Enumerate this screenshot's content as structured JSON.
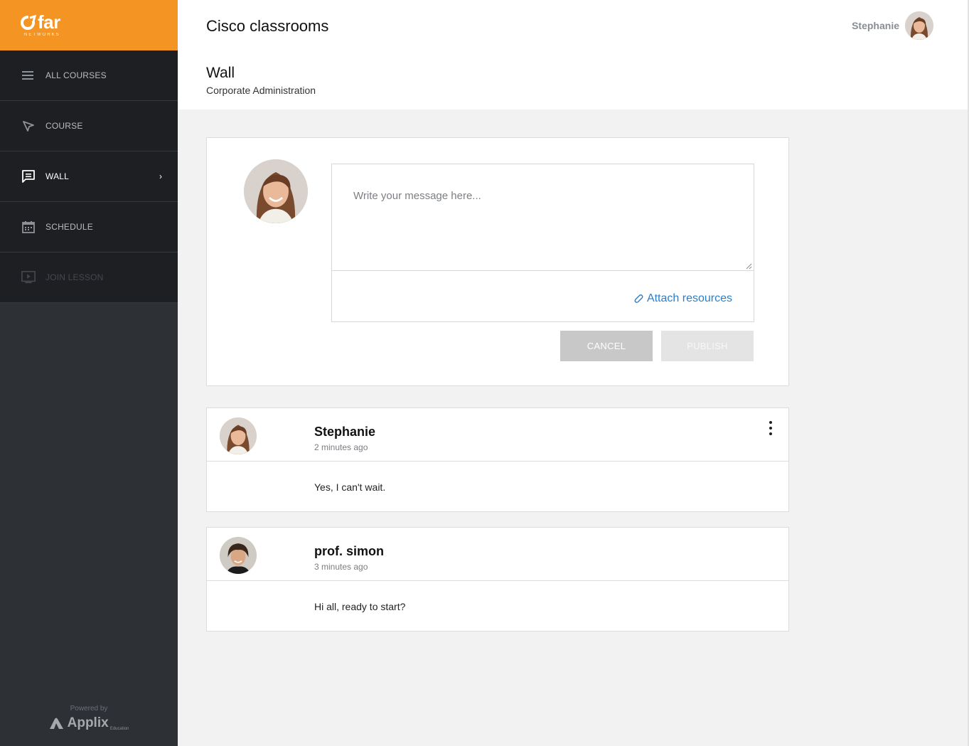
{
  "brand": {
    "logo_text": "far",
    "logo_sub": "NETWORKS",
    "accent_color": "#f39423",
    "powered_by": "Powered by",
    "powered_brand": "Applix",
    "powered_brand_sub": "Education"
  },
  "sidebar": {
    "items": [
      {
        "label": "ALL COURSES",
        "icon": "menu-icon",
        "state": "normal"
      },
      {
        "label": "COURSE",
        "icon": "cursor-arrow-icon",
        "state": "normal"
      },
      {
        "label": "WALL",
        "icon": "message-icon",
        "state": "active",
        "chevron": "›"
      },
      {
        "label": "SCHEDULE",
        "icon": "calendar-icon",
        "state": "normal"
      },
      {
        "label": "JOIN LESSON",
        "icon": "video-play-icon",
        "state": "disabled"
      }
    ]
  },
  "header": {
    "app_title": "Cisco classrooms",
    "page_title": "Wall",
    "page_subtitle": "Corporate Administration",
    "user_name": "Stephanie"
  },
  "composer": {
    "placeholder": "Write your message here...",
    "attach_label": "Attach resources",
    "cancel_label": "CANCEL",
    "publish_label": "PUBLISH"
  },
  "posts": [
    {
      "author": "Stephanie",
      "time": "2 minutes ago",
      "text": "Yes, I can't wait."
    },
    {
      "author": "prof. simon",
      "time": "3 minutes ago",
      "text": "Hi all, ready to start?"
    }
  ]
}
